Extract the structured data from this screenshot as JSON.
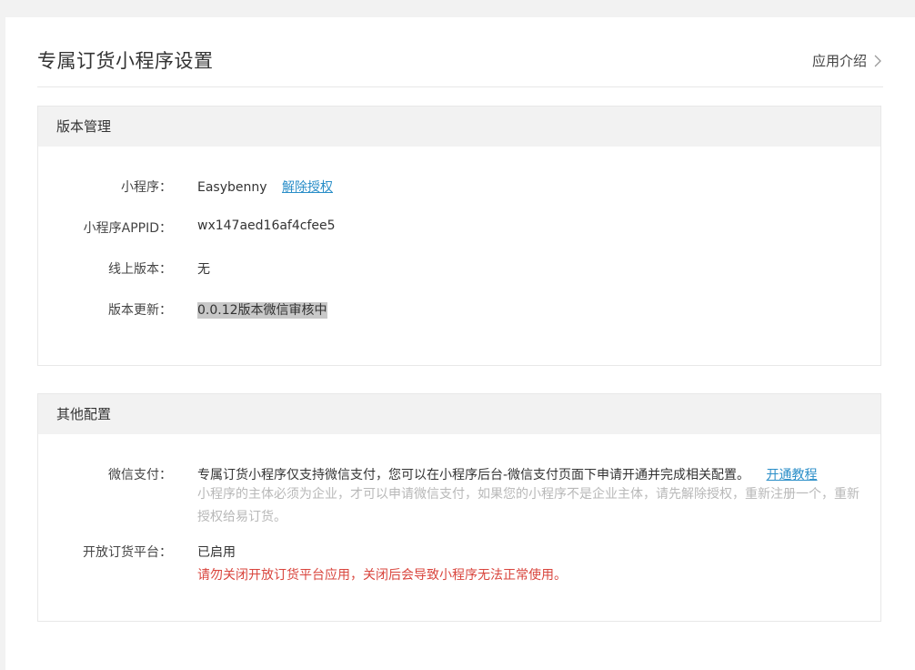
{
  "page": {
    "title": "专属订货小程序设置",
    "intro_link": "应用介绍"
  },
  "version_section": {
    "title": "版本管理",
    "miniapp_label": "小程序：",
    "miniapp_name": "Easybenny",
    "revoke_link": "解除授权",
    "appid_label": "小程序APPID：",
    "appid_value": "wx147aed16af4cfee5",
    "online_label": "线上版本：",
    "online_value": "无",
    "update_label": "版本更新：",
    "update_value": "0.0.12版本微信审核中"
  },
  "other_section": {
    "title": "其他配置",
    "pay_label": "微信支付：",
    "pay_desc": "专属订货小程序仅支持微信支付，您可以在小程序后台-微信支付页面下申请开通并完成相关配置。",
    "pay_tutorial_link": "开通教程",
    "pay_note": "小程序的主体必须为企业，才可以申请微信支付，如果您的小程序不是企业主体，请先解除授权，重新注册一个，重新授权给易订货。",
    "platform_label": "开放订货平台：",
    "platform_status": "已启用",
    "platform_warning": "请勿关闭开放订货平台应用，关闭后会导致小程序无法正常使用。"
  }
}
